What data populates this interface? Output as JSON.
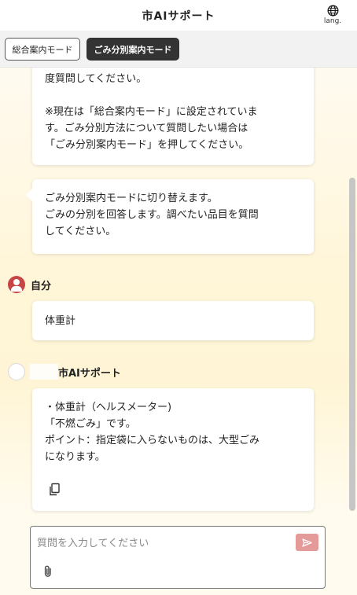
{
  "header": {
    "title": "市AIサポート",
    "lang_label": "lang."
  },
  "modes": {
    "general_label": "総合案内モード",
    "garbage_label": "ごみ分別案内モード"
  },
  "messages": {
    "ai1": {
      "line1": "度質問してください。",
      "line2": "※現在は「総合案内モード」に設定されていま",
      "line3": "す。ごみ分別方法について質問したい場合は",
      "line4": "「ごみ分別案内モード」を押してください。"
    },
    "ai2": {
      "line1": "ごみ分別案内モードに切り替えます。",
      "line2": "ごみの分別を回答します。調べたい品目を質問",
      "line3": "してください。"
    },
    "user": {
      "name": "自分",
      "text": "体重計"
    },
    "ai3": {
      "name": "市AIサポート",
      "line1": "・体重計（ヘルスメーター)",
      "line2": "「不燃ごみ」です。",
      "line3": "ポイント：指定袋に入らないものは、大型ごみ",
      "line4": "になります。"
    }
  },
  "input": {
    "placeholder": "質問を入力してください",
    "value": ""
  },
  "icons": {
    "lang": "globe-icon",
    "copy": "copy-icon",
    "send": "send-icon",
    "attach": "paperclip-icon",
    "user_avatar": "user-avatar-icon",
    "ai_avatar": "ai-avatar-icon"
  },
  "colors": {
    "active_mode_bg": "#333333",
    "user_avatar": "#c94444",
    "send_button": "#e59a9a",
    "chat_background": "#fff6d9"
  }
}
